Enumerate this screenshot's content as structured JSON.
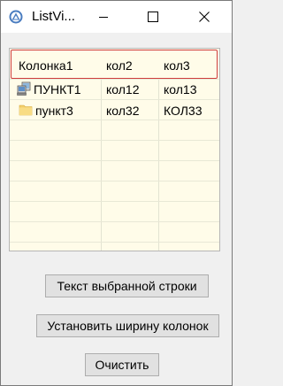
{
  "window": {
    "title": "ListVi..."
  },
  "listview": {
    "columns": [
      "Колонка1",
      "кол2",
      "кол3"
    ],
    "rows": [
      {
        "icon": "computer-icon",
        "cells": [
          "ПУНКТ1",
          "кол12",
          "кол13"
        ]
      },
      {
        "icon": "folder-icon",
        "cells": [
          "пункт3",
          "кол32",
          "КОЛ33"
        ]
      }
    ],
    "background_color": "#fffce9",
    "header_highlight_color": "#cf3d3d"
  },
  "buttons": {
    "selected_row_text": "Текст выбранной строки",
    "set_column_width": "Установить ширину колонок",
    "clear": "Очистить"
  }
}
